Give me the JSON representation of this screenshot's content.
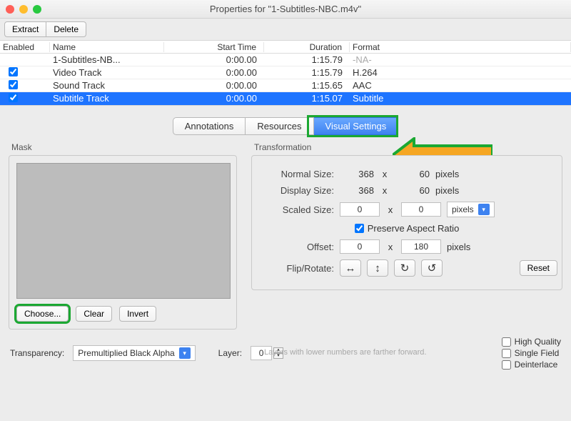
{
  "window": {
    "title": "Properties for \"1-Subtitles-NBC.m4v\""
  },
  "toolbar": {
    "extract": "Extract",
    "delete": "Delete"
  },
  "table": {
    "headers": {
      "enabled": "Enabled",
      "name": "Name",
      "start": "Start Time",
      "duration": "Duration",
      "format": "Format"
    },
    "rows": [
      {
        "enabled": false,
        "show_check": false,
        "name": "1-Subtitles-NB...",
        "start": "0:00.00",
        "duration": "1:15.79",
        "format": "-NA-"
      },
      {
        "enabled": true,
        "show_check": true,
        "name": "Video Track",
        "start": "0:00.00",
        "duration": "1:15.79",
        "format": "H.264"
      },
      {
        "enabled": true,
        "show_check": true,
        "name": "Sound Track",
        "start": "0:00.00",
        "duration": "1:15.65",
        "format": "AAC"
      },
      {
        "enabled": true,
        "show_check": true,
        "name": "Subtitle Track",
        "start": "0:00.00",
        "duration": "1:15.07",
        "format": "Subtitle",
        "selected": true
      }
    ]
  },
  "tabs": {
    "annotations": "Annotations",
    "resources": "Resources",
    "visual": "Visual Settings"
  },
  "mask": {
    "label": "Mask",
    "choose": "Choose...",
    "clear": "Clear",
    "invert": "Invert"
  },
  "transparency": {
    "label": "Transparency:",
    "value": "Premultiplied Black Alpha"
  },
  "trans": {
    "label": "Transformation",
    "normal": "Normal Size:",
    "display": "Display Size:",
    "scaled": "Scaled Size:",
    "offset": "Offset:",
    "flip": "Flip/Rotate:",
    "normal_w": "368",
    "normal_h": "60",
    "display_w": "368",
    "display_h": "60",
    "scaled_w": "0",
    "scaled_h": "0",
    "offset_x": "0",
    "offset_y": "180",
    "x": "x",
    "pixels": "pixels",
    "preserve": "Preserve Aspect Ratio",
    "reset": "Reset",
    "unit_select": "pixels"
  },
  "layer": {
    "label": "Layer:",
    "value": "0",
    "hint": "Layers with lower numbers are farther forward."
  },
  "opts": {
    "hq": "High Quality",
    "single": "Single Field",
    "deint": "Deinterlace"
  }
}
